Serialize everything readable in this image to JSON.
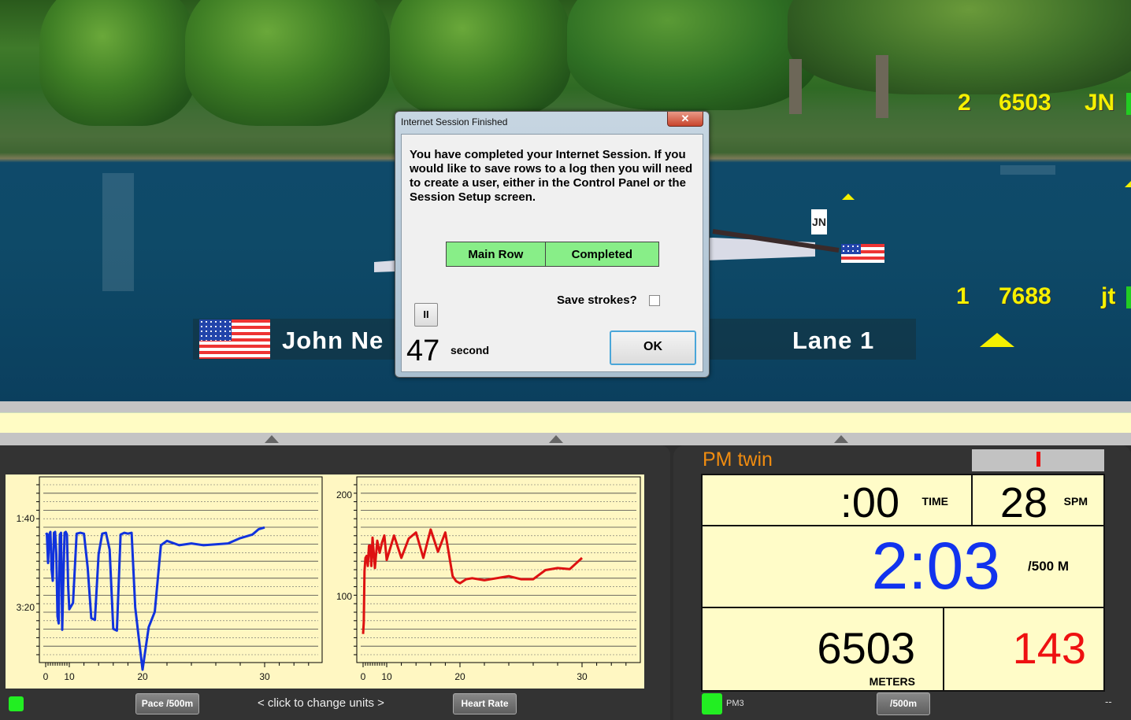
{
  "scene": {
    "leaderboard": [
      {
        "place": "2",
        "distance": "6503",
        "initials": "JN"
      },
      {
        "place": "1",
        "distance": "7688",
        "initials": "jt"
      }
    ],
    "boat_tag": "JN",
    "name_banner": {
      "name": "John Ne",
      "lane": "Lane  1"
    }
  },
  "dialog": {
    "title": "Internet Session Finished",
    "close_glyph": "✕",
    "message": "You have completed your Internet Session.  If you would like to save rows to a log then you will need to create a user, either in the Control Panel or the Session Setup screen.",
    "status": {
      "row": "Main Row",
      "state": "Completed"
    },
    "save_strokes_label": "Save strokes?",
    "save_strokes_checked": false,
    "pause_glyph": "II",
    "countdown": "47",
    "countdown_unit": "second",
    "ok_label": "OK"
  },
  "graphs": {
    "pace_button": "Pace /500m",
    "units_hint": "<  click to change units  >",
    "hr_button": "Heart Rate"
  },
  "monitor": {
    "title": "PM twin",
    "force_indicator": 0.5,
    "time": ":00",
    "time_label": "TIME",
    "spm": "28",
    "spm_label": "SPM",
    "pace": "2:03",
    "pace_label": "/500 M",
    "meters": "6503",
    "meters_label": "METERS",
    "heart_rate": "143",
    "device": "PM3",
    "units_button": "/500m",
    "extra": "--",
    "colors": {
      "pace": "#1133ee",
      "heart_rate": "#ee1111",
      "title": "#f08c10"
    }
  },
  "chart_data": [
    {
      "type": "line",
      "title": "Pace /500m",
      "xlabel": "",
      "ylabel": "",
      "x_ticks": [
        "0",
        "10",
        "20",
        "30"
      ],
      "y_ticks": [
        "1:40",
        "3:20"
      ],
      "y_inverted": true,
      "ylim_seconds": [
        45,
        250
      ],
      "color": "#1133dd",
      "series": [
        {
          "name": "Pace (s/500m)",
          "x": [
            0,
            0.5,
            1,
            1.5,
            2,
            2.5,
            3,
            3.5,
            4,
            4.5,
            5,
            5.5,
            6,
            6.5,
            7,
            7.5,
            8,
            8.5,
            9,
            9.5,
            10,
            10.5,
            11,
            11.5,
            12,
            12.5,
            13,
            13.5,
            14,
            14.5,
            15,
            15.5,
            16,
            16.5,
            17,
            17.5,
            18,
            18.5,
            19,
            19.5,
            20,
            20.5,
            21,
            21.5,
            22,
            23,
            24,
            25,
            26,
            27,
            28,
            29,
            29.5,
            30
          ],
          "y": [
            118,
            117,
            150,
            118,
            115,
            157,
            170,
            116,
            115,
            140,
            210,
            218,
            118,
            116,
            225,
            168,
            116,
            115,
            118,
            175,
            202,
            195,
            117,
            116,
            117,
            155,
            212,
            214,
            140,
            117,
            116,
            135,
            224,
            226,
            118,
            116,
            117,
            116,
            200,
            235,
            270,
            222,
            205,
            130,
            125,
            130,
            128,
            130,
            129,
            128,
            122,
            118,
            112,
            110
          ]
        }
      ]
    },
    {
      "type": "line",
      "title": "Heart Rate",
      "xlabel": "",
      "ylabel": "",
      "x_ticks": [
        "0",
        "10",
        "20",
        "30"
      ],
      "y_ticks": [
        "100",
        "200"
      ],
      "ylim": [
        52,
        216
      ],
      "color": "#dd1111",
      "series": [
        {
          "name": "Heart Rate (bpm)",
          "x": [
            0,
            0.3,
            0.6,
            1,
            1.5,
            2,
            2.5,
            3,
            3.5,
            4,
            5,
            6,
            7,
            8,
            9,
            10,
            11,
            12,
            13,
            14,
            15,
            16,
            17,
            18,
            19,
            19.5,
            20,
            20.5,
            21,
            22,
            23,
            24,
            25,
            26,
            27,
            28,
            29,
            30
          ],
          "y": [
            63,
            75,
            125,
            138,
            140,
            130,
            150,
            150,
            130,
            158,
            128,
            155,
            143,
            153,
            160,
            136,
            160,
            138,
            157,
            163,
            138,
            166,
            144,
            163,
            120,
            115,
            113,
            117,
            118,
            116,
            118,
            120,
            117,
            117,
            126,
            128,
            127,
            138
          ]
        }
      ]
    }
  ]
}
